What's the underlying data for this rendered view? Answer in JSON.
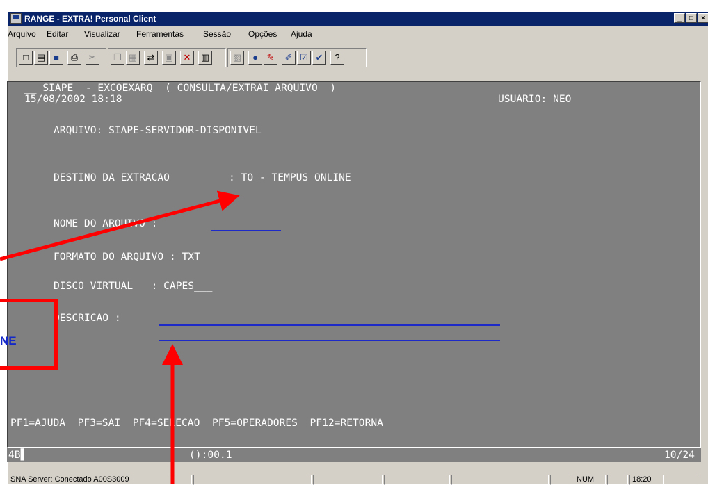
{
  "window": {
    "title": "RANGE - EXTRA! Personal Client",
    "controls": {
      "minimize": "_",
      "maximize": "□",
      "close": "×"
    }
  },
  "menu": [
    "Arquivo",
    "Editar",
    "Visualizar",
    "Ferramentas",
    "Sessão",
    "Opções",
    "Ajuda"
  ],
  "toolbar": {
    "icons": [
      "new-icon",
      "open-icon",
      "save-icon",
      "print-icon",
      "cut-icon",
      "copy-icon",
      "paste-icon",
      "connect-icon",
      "send-icon",
      "tools-icon",
      "transfer-icon",
      "receive-icon",
      "record-icon",
      "macro-icon",
      "edit-icon",
      "check-icon",
      "check2-icon",
      "help-icon"
    ]
  },
  "terminal": {
    "header_line1": "__ SIAPE  - EXCOEXARQ  ( CONSULTA/EXTRAI ARQUIVO  )",
    "header_date": "15/08/2002 18:18",
    "usuario": "USUARIO: NEO",
    "arquivo": "ARQUIVO: SIAPE-SERVIDOR-DISPONIVEL",
    "destino_label": "DESTINO DA EXTRACAO",
    "destino_value": ": TO - TEMPUS ONLINE",
    "nome_label": "NOME DO ARQUIVO : ",
    "nome_value": "_",
    "formato": "FORMATO DO ARQUIVO : TXT",
    "disco": "DISCO VIRTUAL   : CAPES___",
    "descricao_label": "DESCRICAO : ",
    "pf_keys": "PF1=AJUDA  PF3=SAI  PF4=SELECAO  PF5=OPERADORES  PF12=RETORNA"
  },
  "oia": {
    "left": "4B▌",
    "middle": "():00.1",
    "right": "10/24"
  },
  "status": {
    "server": "SNA Server: Conectado A00S3009",
    "num": "NUM",
    "time": "18:20"
  },
  "annotation": {
    "label": "NE"
  },
  "colors": {
    "title_bar": "#0a246a",
    "terminal_bg": "#808080",
    "field_underline": "#1e2ac8",
    "arrow": "#ff0000"
  }
}
